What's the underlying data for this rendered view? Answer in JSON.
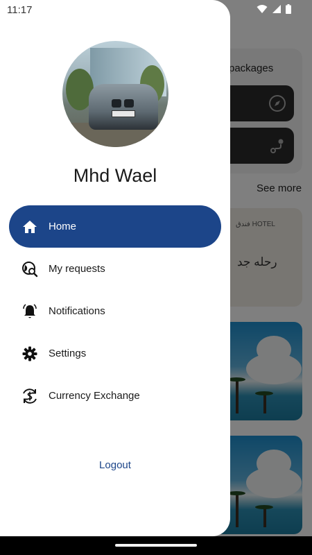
{
  "status_bar": {
    "time": "11:17"
  },
  "background": {
    "packages_title": "packages",
    "see_more": "See more",
    "hotel_arabic": "رحله جد",
    "hotel_arabic_small": "فندق HOTEL"
  },
  "drawer": {
    "user_name": "Mhd Wael",
    "menu": [
      {
        "label": "Home",
        "icon": "home-icon",
        "active": true
      },
      {
        "label": "My requests",
        "icon": "travel-search-icon",
        "active": false
      },
      {
        "label": "Notifications",
        "icon": "bell-icon",
        "active": false
      },
      {
        "label": "Settings",
        "icon": "gear-icon",
        "active": false
      },
      {
        "label": "Currency Exchange",
        "icon": "currency-exchange-icon",
        "active": false
      }
    ],
    "logout_label": "Logout"
  },
  "colors": {
    "accent": "#1c4589",
    "drawer_bg": "#ffffff"
  }
}
